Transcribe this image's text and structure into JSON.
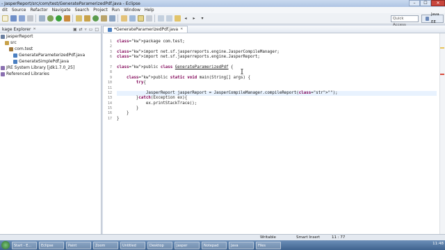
{
  "window": {
    "title": "- JasperReport/src/com/test/GenerateParamerizedPdf.java - Eclipse",
    "min_label": "–",
    "max_label": "☐",
    "close_label": "✕"
  },
  "menu": [
    "dit",
    "Source",
    "Refactor",
    "Navigate",
    "Search",
    "Project",
    "Run",
    "Window",
    "Help"
  ],
  "toolbar": {
    "quick_access_placeholder": "Quick Access",
    "perspective_label": "Java EE"
  },
  "package_explorer": {
    "tab_label": "kage Explorer",
    "close_label": "✕",
    "tree": [
      {
        "label": "JasperReport",
        "indent": 0,
        "icon": "project-icon",
        "color": "#6a7fa0"
      },
      {
        "label": "src",
        "indent": 1,
        "icon": "source-folder-icon",
        "color": "#c8a24a"
      },
      {
        "label": "com.test",
        "indent": 2,
        "icon": "package-icon",
        "color": "#a0783b"
      },
      {
        "label": "GenerateParameterizedPdf.java",
        "indent": 3,
        "icon": "java-file-icon",
        "color": "#4a7fc1"
      },
      {
        "label": "GenerateSimplePdf.java",
        "indent": 3,
        "icon": "java-file-icon",
        "color": "#4a7fc1"
      },
      {
        "label": "JRE System Library [jdk1.7.0_25]",
        "indent": 0,
        "icon": "library-icon",
        "color": "#8a6fb0"
      },
      {
        "label": "Referenced Libraries",
        "indent": 0,
        "icon": "library-icon",
        "color": "#8a6fb0"
      }
    ]
  },
  "editor": {
    "tab_label": "*GenerateParamerizedPdf.java",
    "tab_close": "✕",
    "line_numbers": [
      "1",
      "2",
      "3",
      "6",
      "7",
      "8",
      "9",
      "10",
      "11",
      "12",
      "13",
      "14",
      "15",
      "16",
      "17"
    ],
    "lines": [
      "package com.test;",
      "",
      "import net.sf.jasperreports.engine.JasperCompileManager;",
      "import net.sf.jasperreports.engine.JasperReport;",
      "",
      "public class GenerateParamerizedPdf {",
      "",
      "    public static void main(String[] args) {",
      "        try{",
      "",
      "            JasperReport jasperReport = JasperCompileManager.compileReport(\"\");",
      "        }catch(Exception ex){",
      "            ex.printStackTrace();",
      "        }",
      "    }",
      "}"
    ]
  },
  "status_bar": {
    "writable": "Writable",
    "insert_mode": "Smart Insert",
    "position": "11 : 77"
  },
  "taskbar": {
    "clock": "11:48",
    "buttons": [
      "Start - E...",
      "Eclipse",
      "Paint",
      "Zoom",
      "Untitled",
      "Desktop",
      "Jasper",
      "Notepad",
      "Java",
      "Files"
    ]
  }
}
